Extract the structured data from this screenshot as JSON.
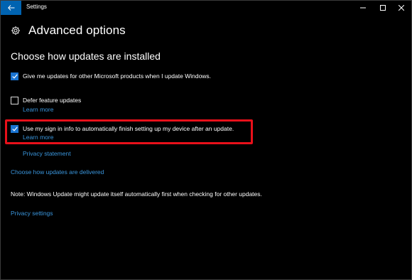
{
  "window": {
    "title": "Settings"
  },
  "header": {
    "title": "Advanced options"
  },
  "section": {
    "heading": "Choose how updates are installed"
  },
  "options": [
    {
      "label": "Give me updates for other Microsoft products when I update Windows.",
      "checked": true
    },
    {
      "label": "Defer feature updates",
      "checked": false,
      "link": "Learn more"
    },
    {
      "label": "Use my sign in info to automatically finish setting up my device after an update.",
      "checked": true,
      "link": "Learn more"
    }
  ],
  "links": {
    "privacy_statement": "Privacy statement",
    "delivery": "Choose how updates are delivered",
    "privacy_settings": "Privacy settings"
  },
  "note": "Note: Windows Update might update itself automatically first when checking for other updates.",
  "colors": {
    "accent": "#0063b1",
    "link": "#3a96dd",
    "highlight": "#e8101a",
    "checkbox": "#1a73d0"
  }
}
